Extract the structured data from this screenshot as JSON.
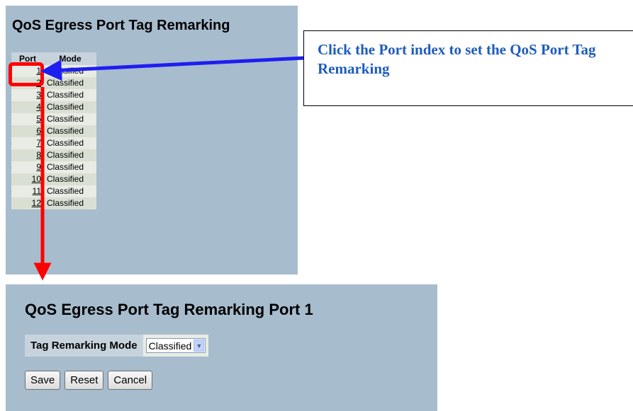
{
  "list_panel": {
    "title": "QoS Egress Port Tag Remarking",
    "columns": {
      "port": "Port",
      "mode": "Mode"
    },
    "rows": [
      {
        "port": "1",
        "mode": "Classified"
      },
      {
        "port": "2",
        "mode": "Classified"
      },
      {
        "port": "3",
        "mode": "Classified"
      },
      {
        "port": "4",
        "mode": "Classified"
      },
      {
        "port": "5",
        "mode": "Classified"
      },
      {
        "port": "6",
        "mode": "Classified"
      },
      {
        "port": "7",
        "mode": "Classified"
      },
      {
        "port": "8",
        "mode": "Classified"
      },
      {
        "port": "9",
        "mode": "Classified"
      },
      {
        "port": "10",
        "mode": "Classified"
      },
      {
        "port": "11",
        "mode": "Classified"
      },
      {
        "port": "12",
        "mode": "Classified"
      }
    ]
  },
  "callout": {
    "text": "Click the Port index to set the QoS Port Tag Remarking",
    "color": "#1f5cbc"
  },
  "detail_panel": {
    "title": "QoS Egress Port Tag Remarking  Port 1",
    "mode_label": "Tag Remarking Mode",
    "mode_value": "Classified",
    "buttons": {
      "save": "Save",
      "reset": "Reset",
      "cancel": "Cancel"
    }
  },
  "colors": {
    "panel_bg": "#a7bccd",
    "header_bg": "#c7d3dc",
    "row_odd": "#e8ece4",
    "row_even": "#d9e0d3",
    "highlight": "#ff0000",
    "pointer_arrow": "#1e1ef0"
  },
  "icons": {
    "select_arrow": "chevron-down-icon"
  }
}
